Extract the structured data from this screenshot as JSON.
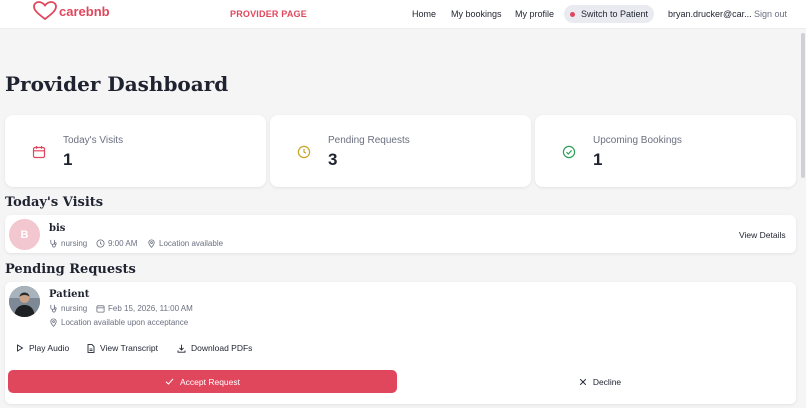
{
  "header": {
    "logo_text": "carebnb",
    "provider_link": "PROVIDER PAGE",
    "nav": [
      "Home",
      "My bookings",
      "My profile"
    ],
    "switch_label": "Switch to Patient",
    "user_email": "bryan.drucker@car...",
    "sign_out": "Sign out"
  },
  "page": {
    "title": "Provider Dashboard"
  },
  "stats": [
    {
      "label": "Today's Visits",
      "value": "1",
      "icon": "calendar-icon",
      "color": "#e0475d"
    },
    {
      "label": "Pending Requests",
      "value": "3",
      "icon": "clock-icon",
      "color": "#c9a227"
    },
    {
      "label": "Upcoming Bookings",
      "value": "1",
      "icon": "check-circle-icon",
      "color": "#2f9e5a"
    }
  ],
  "todays_visits": {
    "title": "Today's Visits",
    "items": [
      {
        "initial": "B",
        "name": "bis",
        "service": "nursing",
        "time": "9:00 AM",
        "location": "Location available",
        "action": "View Details"
      }
    ]
  },
  "pending_requests": {
    "title": "Pending Requests",
    "items": [
      {
        "name": "Patient",
        "service": "nursing",
        "datetime": "Feb 15, 2026, 11:00 AM",
        "location": "Location available upon acceptance",
        "actions": {
          "play_audio": "Play Audio",
          "view_transcript": "View Transcript",
          "download_pdfs": "Download PDFs"
        },
        "accept": "Accept Request",
        "decline": "Decline"
      }
    ]
  },
  "colors": {
    "brand": "#e0475d",
    "background": "#f5f5f6",
    "card": "#ffffff"
  }
}
